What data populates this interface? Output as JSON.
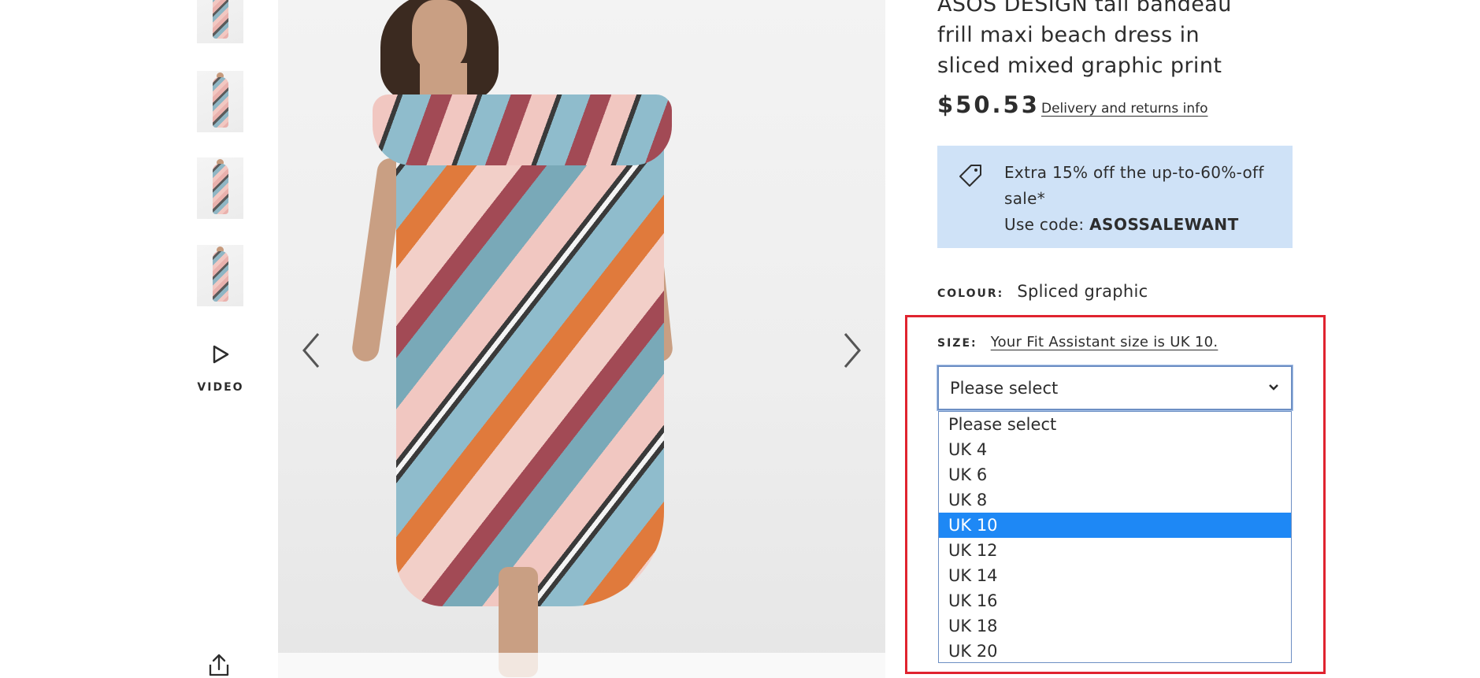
{
  "gallery": {
    "thumbnail_count": 4,
    "video_label": "VIDEO"
  },
  "product": {
    "title_lines": [
      "ASOS DESIGN tall bandeau",
      "frill maxi beach dress in",
      "sliced mixed graphic print"
    ],
    "price": "$50.53",
    "delivery_link": "Delivery and returns info"
  },
  "promo": {
    "line1": "Extra 15% off the up-to-60%-off sale*",
    "code_prefix": "Use code: ",
    "code": "ASOSSALEWANT",
    "background": "#cfe2f7"
  },
  "colour": {
    "label": "COLOUR:",
    "value": "Spliced graphic"
  },
  "size": {
    "label": "SIZE:",
    "fit_assistant_link": "Your Fit Assistant size is UK 10.",
    "select_value": "Please select",
    "options": [
      "Please select",
      "UK 4",
      "UK 6",
      "UK 8",
      "UK 10",
      "UK 12",
      "UK 14",
      "UK 16",
      "UK 18",
      "UK 20"
    ],
    "highlighted_option": "UK 10"
  },
  "colors": {
    "highlight_border": "#e0232f",
    "selected_option": "#1e88f5",
    "text": "#2d2d2d"
  },
  "icons": {
    "promo": "price-tag-icon",
    "video": "play-icon",
    "share": "share-icon",
    "carousel_prev": "chevron-left-icon",
    "carousel_next": "chevron-right-icon",
    "select": "chevron-down-icon"
  }
}
